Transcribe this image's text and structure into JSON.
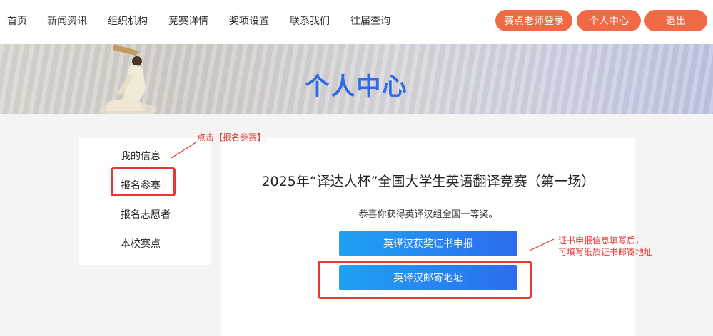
{
  "nav": {
    "items": [
      "首页",
      "新闻资讯",
      "组织机构",
      "竞赛详情",
      "奖项设置",
      "联系我们",
      "往届查询"
    ],
    "buttons": {
      "teacher_login": "赛点老师登录",
      "personal_center": "个人中心",
      "logout": "退出"
    }
  },
  "banner": {
    "title": "个人中心"
  },
  "sidebar": {
    "items": [
      "我的信息",
      "报名参赛",
      "报名志愿者",
      "本校赛点"
    ]
  },
  "main": {
    "competition_title": "2025年“译达人杯”全国大学生英语翻译竞赛（第一场）",
    "congrats": "恭喜你获得英译汉组全国一等奖。",
    "btn_certificate": "英译汉获奖证书申报",
    "btn_mailing": "英译汉邮寄地址"
  },
  "annotations": {
    "click_signup": "点击【报名参赛】",
    "cert_note_line1": "证书申报信息填写后，",
    "cert_note_line2": "可填写纸质证书邮寄地址"
  },
  "colors": {
    "accent_orange": "#f26a45",
    "title_blue": "#2f6be8",
    "button_gradient_start": "#1fa2f3",
    "button_gradient_end": "#2d6cf0",
    "annotation_red": "#e53935"
  }
}
